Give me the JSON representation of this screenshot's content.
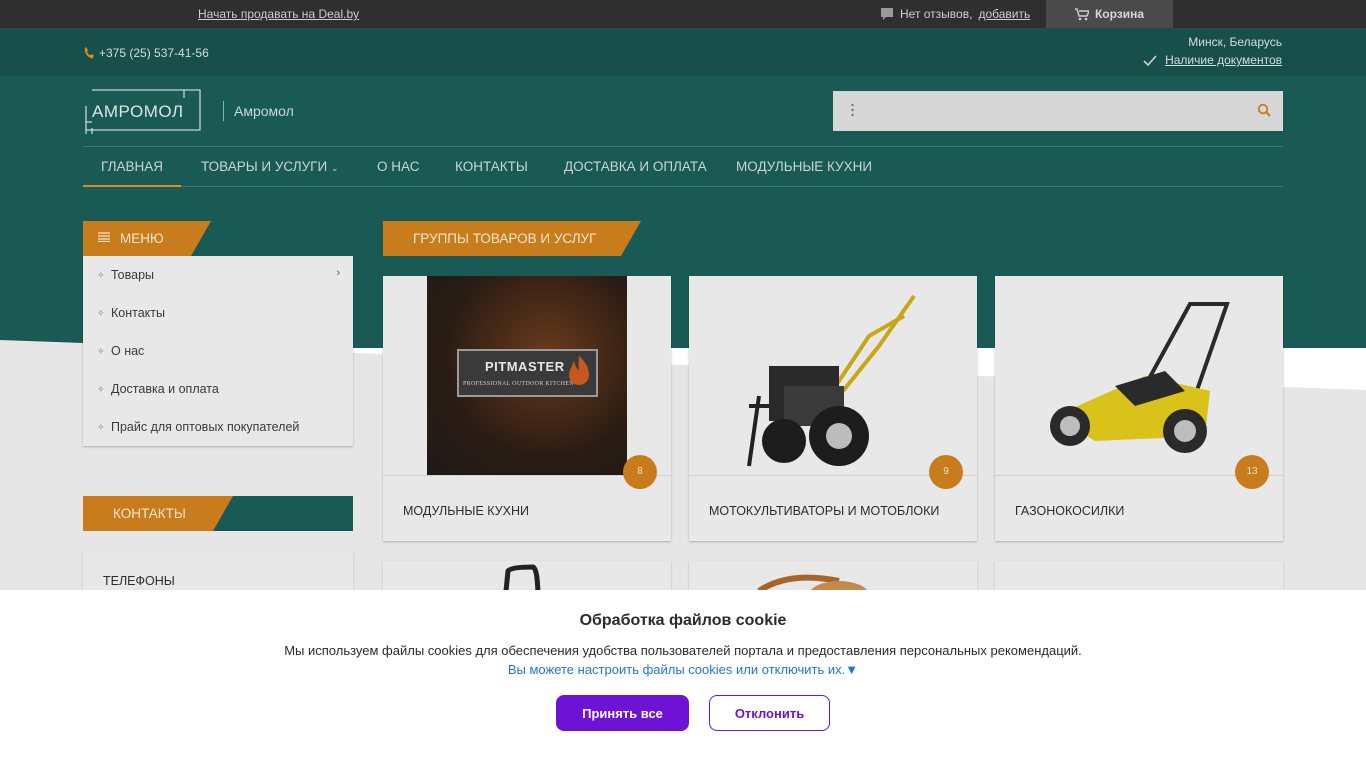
{
  "topbar": {
    "sell_link": "Начать продавать на Deal.by",
    "reviews_text": "Нет отзывов,",
    "reviews_add": "добавить",
    "cart_label": "Корзина"
  },
  "header": {
    "phone": "+375 (25) 537-41-56",
    "location": "Минск, Беларусь",
    "documents": "Наличие документов",
    "logo_text": "АМРОМОЛ",
    "brand_name": "Амромол",
    "search_placeholder": ""
  },
  "nav": {
    "items": [
      {
        "label": "ГЛАВНАЯ",
        "active": true
      },
      {
        "label": "ТОВАРЫ И УСЛУГИ",
        "has_dropdown": true
      },
      {
        "label": "О НАС"
      },
      {
        "label": "КОНТАКТЫ"
      },
      {
        "label": "ДОСТАВКА И ОПЛАТА"
      },
      {
        "label": "МОДУЛЬНЫЕ КУХНИ"
      }
    ]
  },
  "sidebar": {
    "menu_title": "МЕНЮ",
    "menu_items": [
      {
        "label": "Товары",
        "has_children": true
      },
      {
        "label": "Контакты"
      },
      {
        "label": "О нас"
      },
      {
        "label": "Доставка и оплата"
      },
      {
        "label": "Прайс для оптовых покупателей"
      }
    ],
    "contacts_title": "КОНТАКТЫ",
    "phones_title": "ТЕЛЕФОНЫ"
  },
  "main": {
    "groups_title": "ГРУППЫ ТОВАРОВ И УСЛУГ",
    "cards": [
      {
        "name": "МОДУЛЬНЫЕ КУХНИ",
        "count": "8",
        "image_text_1": "PITMASTER",
        "image_text_2": "PROFESSIONAL OUTDOOR KITCHEN"
      },
      {
        "name": "МОТОКУЛЬТИВАТОРЫ И МОТОБЛОКИ",
        "count": "9"
      },
      {
        "name": "ГАЗОНОКОСИЛКИ",
        "count": "13"
      }
    ]
  },
  "cookie": {
    "title": "Обработка файлов cookie",
    "text": "Мы используем файлы cookies для обеспечения удобства пользователей портала и предоставления персональных рекомендаций.",
    "settings_link": "Вы можете настроить файлы cookies или отключить их.▼",
    "accept_label": "Принять все",
    "decline_label": "Отклонить"
  },
  "colors": {
    "teal_dark": "#1a5a55",
    "accent_orange": "#c87c1b",
    "cookie_purple": "#6e12d6",
    "link_blue": "#1f74d9"
  }
}
